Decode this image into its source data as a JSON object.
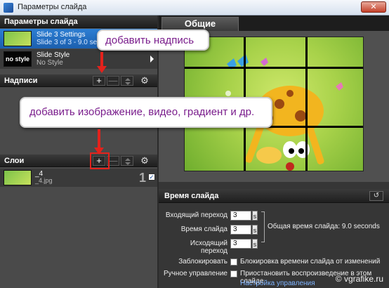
{
  "window": {
    "title": "Параметры слайда",
    "close_glyph": "✕"
  },
  "left": {
    "header": "Параметры слайда",
    "slides": [
      {
        "thumb": "",
        "line1": "Slide 3 Settings",
        "line2": "Slide 3 of 3 - 9.0 sec",
        "selected": true
      },
      {
        "thumb": "no style",
        "line1": "Slide Style",
        "line2": "No Style",
        "selected": false
      }
    ],
    "captions_label": "Надписи",
    "layers_label": "Слои",
    "layer": {
      "name": "_4",
      "file": "_4.jpg",
      "number": "1",
      "checked": "✓"
    },
    "toolbar": {
      "add": "+",
      "remove": "—",
      "gear": "⚙"
    }
  },
  "right": {
    "tab": "Общие",
    "time_section": {
      "title": "Время слайда",
      "reset_glyph": "↺",
      "fields": [
        {
          "label": "Входящий переход",
          "value": "3",
          "unit": "s"
        },
        {
          "label": "Время слайда",
          "value": "3",
          "unit": "s"
        },
        {
          "label": "Исходящий переход",
          "value": "3",
          "unit": "s"
        }
      ],
      "total": "Общая время слайда: 9.0 seconds",
      "lock_label": "Заблокировать",
      "lock_text": "Блокировка времени слайда от изменений",
      "manual_label": "Ручное управление",
      "manual_text": "Приостановить воспроизведение в этом слайде",
      "manual_link": "Настройка управления"
    }
  },
  "callouts": {
    "add_caption": "добавить надпись",
    "add_media": "добавить изображение, видео, градиент и др."
  },
  "watermark": "© vgrafike.ru",
  "colors": {
    "accent_red": "#e3221c",
    "callout_text": "#7a1d8c",
    "selected_row": "#2d7fd4"
  }
}
